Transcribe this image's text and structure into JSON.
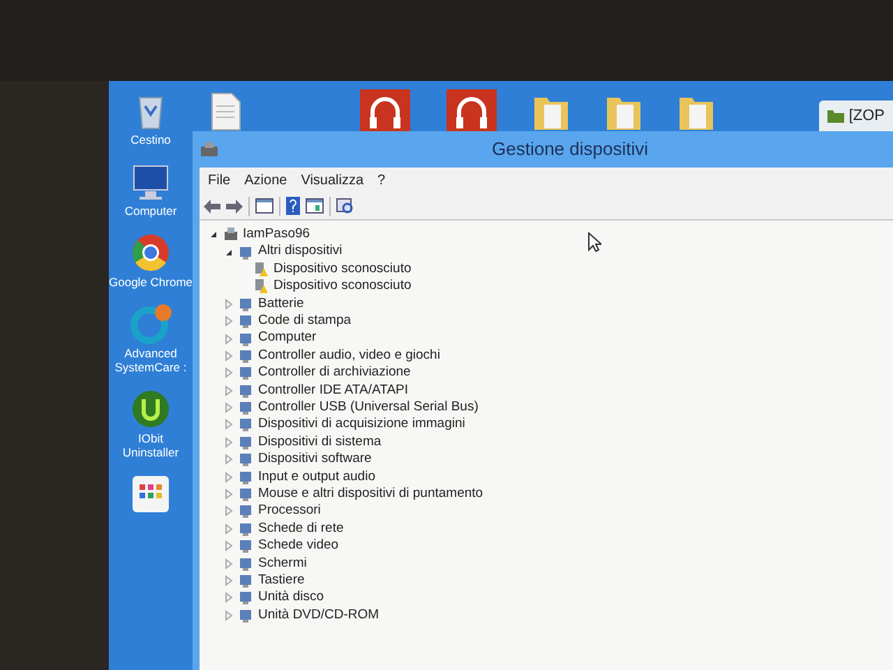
{
  "desktop_icons": [
    {
      "label": "Cestino",
      "kind": "bin"
    },
    {
      "label": "Computer",
      "kind": "computer"
    },
    {
      "label": "Google Chrome",
      "kind": "browser"
    },
    {
      "label": "Advanced SystemCare :",
      "kind": "care"
    },
    {
      "label": "IObit Uninstaller",
      "kind": "uninstall"
    },
    {
      "kind": "tiles"
    }
  ],
  "taskbar_tab": {
    "label": "[ZOP"
  },
  "window": {
    "title": "Gestione dispositivi"
  },
  "menu": [
    "File",
    "Azione",
    "Visualizza",
    "?"
  ],
  "tree": {
    "label": "IamPaso96",
    "expanded": true,
    "children": [
      {
        "label": "Altri dispositivi",
        "expanded": true,
        "children": [
          {
            "label": "Dispositivo sconosciuto",
            "warning": true
          },
          {
            "label": "Dispositivo sconosciuto",
            "warning": true
          }
        ]
      },
      {
        "label": "Batterie",
        "expanded": false
      },
      {
        "label": "Code di stampa",
        "expanded": false
      },
      {
        "label": "Computer",
        "expanded": false
      },
      {
        "label": "Controller audio, video e giochi",
        "expanded": false
      },
      {
        "label": "Controller di archiviazione",
        "expanded": false
      },
      {
        "label": "Controller IDE ATA/ATAPI",
        "expanded": false
      },
      {
        "label": "Controller USB (Universal Serial Bus)",
        "expanded": false
      },
      {
        "label": "Dispositivi di acquisizione immagini",
        "expanded": false
      },
      {
        "label": "Dispositivi di sistema",
        "expanded": false
      },
      {
        "label": "Dispositivi software",
        "expanded": false
      },
      {
        "label": "Input e output audio",
        "expanded": false
      },
      {
        "label": "Mouse e altri dispositivi di puntamento",
        "expanded": false
      },
      {
        "label": "Processori",
        "expanded": false
      },
      {
        "label": "Schede di rete",
        "expanded": false
      },
      {
        "label": "Schede video",
        "expanded": false
      },
      {
        "label": "Schermi",
        "expanded": false
      },
      {
        "label": "Tastiere",
        "expanded": false
      },
      {
        "label": "Unità disco",
        "expanded": false
      },
      {
        "label": "Unità DVD/CD-ROM",
        "expanded": false
      }
    ]
  }
}
